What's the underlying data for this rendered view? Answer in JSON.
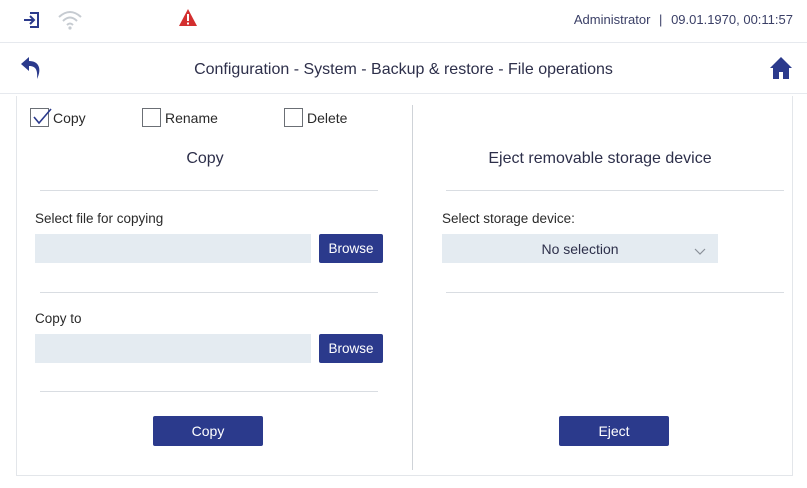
{
  "header": {
    "user": "Administrator",
    "separator": "|",
    "datetime": "09.01.1970, 00:11:57",
    "icons": [
      "login-icon",
      "wifi-icon",
      "warning-icon"
    ]
  },
  "title_bar": {
    "title": "Configuration - System - Backup & restore - File operations",
    "icons": [
      "back-arrow-icon",
      "home-icon"
    ]
  },
  "modes": [
    {
      "label": "Copy",
      "checked": true
    },
    {
      "label": "Rename",
      "checked": false
    },
    {
      "label": "Delete",
      "checked": false
    }
  ],
  "copy_section": {
    "title": "Copy",
    "source_label": "Select file for copying",
    "source_value": "",
    "browse_label": "Browse",
    "target_label": "Copy to",
    "target_value": "",
    "copy_button": "Copy"
  },
  "eject_section": {
    "title": "Eject removable storage device",
    "device_label": "Select storage device:",
    "device_value": "No selection",
    "eject_button": "Eject"
  },
  "colors": {
    "accent": "#2b3a8c",
    "warning": "#d32f2f",
    "field_bg": "#e4ebf1"
  }
}
